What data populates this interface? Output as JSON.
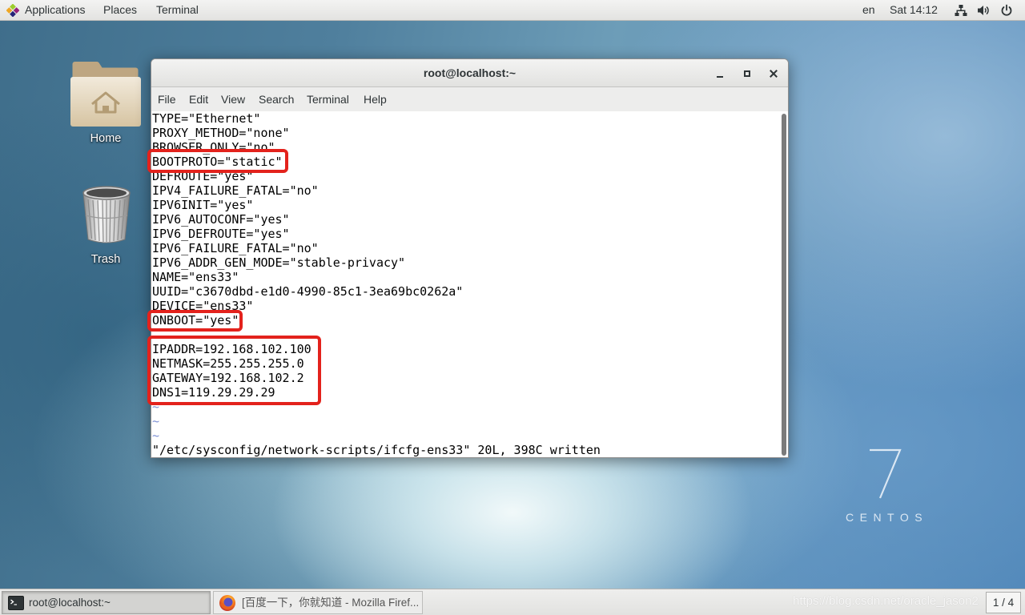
{
  "top_bar": {
    "menus": [
      "Applications",
      "Places",
      "Terminal"
    ],
    "language": "en",
    "clock": "Sat 14:12",
    "icons": {
      "applications": "centos-logo-icon",
      "network": "network-wired-icon",
      "volume": "volume-icon",
      "power": "power-icon"
    }
  },
  "desktop": {
    "home_label": "Home",
    "trash_label": "Trash",
    "icons": {
      "home": "folder-home-icon",
      "trash": "trash-icon"
    },
    "branding": {
      "version": "7",
      "name": "CENTOS"
    }
  },
  "terminal_window": {
    "title": "root@localhost:~",
    "controls": {
      "minimize": "minimize-icon",
      "maximize": "maximize-icon",
      "close": "close-icon"
    },
    "menu": [
      "File",
      "Edit",
      "View",
      "Search",
      "Terminal",
      "Help"
    ],
    "lines": [
      "TYPE=\"Ethernet\"",
      "PROXY_METHOD=\"none\"",
      "BROWSER_ONLY=\"no\"",
      "BOOTPROTO=\"static\"",
      "DEFROUTE=\"yes\"",
      "IPV4_FAILURE_FATAL=\"no\"",
      "IPV6INIT=\"yes\"",
      "IPV6_AUTOCONF=\"yes\"",
      "IPV6_DEFROUTE=\"yes\"",
      "IPV6_FAILURE_FATAL=\"no\"",
      "IPV6_ADDR_GEN_MODE=\"stable-privacy\"",
      "NAME=\"ens33\"",
      "UUID=\"c3670dbd-e1d0-4990-85c1-3ea69bc0262a\"",
      "DEVICE=\"ens33\"",
      "ONBOOT=\"yes\"",
      "",
      "IPADDR=192.168.102.100",
      "NETMASK=255.255.255.0",
      "GATEWAY=192.168.102.2",
      "DNS1=119.29.29.29",
      "~",
      "~",
      "~"
    ],
    "status_line": "\"/etc/sysconfig/network-scripts/ifcfg-ens33\" 20L, 398C written"
  },
  "taskbar": {
    "windows": [
      {
        "label": "root@localhost:~",
        "icon": "terminal-icon"
      },
      {
        "label": "[百度一下，你就知道 - Mozilla Firef...",
        "icon": "firefox-icon"
      }
    ],
    "workspace": "1 / 4",
    "watermark": "https://blog.csdn.net/oracle_jason2"
  },
  "colors": {
    "annotation": "#e3221c",
    "vim_tilde": "#7d90d4"
  }
}
